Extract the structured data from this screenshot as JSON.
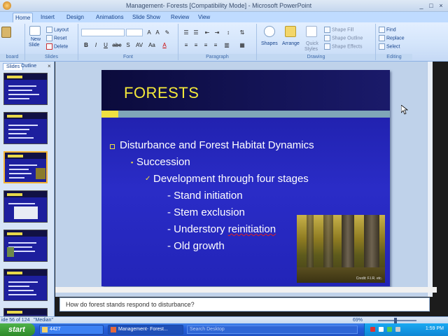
{
  "window": {
    "title": "Management- Forests [Compatibility Mode] - Microsoft PowerPoint",
    "controls": [
      "_",
      "□",
      "×"
    ]
  },
  "ribbon": {
    "tabs": [
      "Home",
      "Insert",
      "Design",
      "Animations",
      "Slide Show",
      "Review",
      "View"
    ],
    "active_tab": "Home",
    "clipboard_label": "board",
    "slides_group": {
      "label": "Slides",
      "new_slide": "New",
      "new_slide_2": "Slide",
      "layout": "Layout",
      "reset": "Reset",
      "delete": "Delete"
    },
    "font_group": {
      "label": "Font",
      "bold": "B",
      "italic": "I",
      "underline": "U",
      "strike": "abc",
      "shadow": "S",
      "spacing": "AV",
      "case": "Aa",
      "color": "A"
    },
    "paragraph_group": {
      "label": "Paragraph"
    },
    "drawing_group": {
      "label": "Drawing",
      "shapes": "Shapes",
      "arrange": "Arrange",
      "quick_styles": "Quick",
      "quick_styles_2": "Styles",
      "shape_fill": "Shape Fill",
      "shape_outline": "Shape Outline",
      "shape_effects": "Shape Effects"
    },
    "editing_group": {
      "label": "Editing",
      "find": "Find",
      "replace": "Replace",
      "select": "Select"
    }
  },
  "left_panel": {
    "tabs": [
      "Slides",
      "Outline"
    ],
    "close": "×",
    "thumbnail_title": "FORESTS"
  },
  "slide": {
    "title": "FORESTS",
    "bullets": [
      "Disturbance and Forest Habitat Dynamics",
      "Succession",
      "Development through four stages",
      "- Stand initiation",
      "- Stem exclusion",
      "- Understory ",
      "reinitiation",
      "- Old growth"
    ],
    "bullet_glyphs": {
      "level2": "▪",
      "level3": "✓"
    },
    "photo_credit": "Credit: F.I.R. etc."
  },
  "notes": {
    "text": "How do forest stands respond to disturbance?"
  },
  "status": {
    "slide_info": "ide 56 of 124",
    "theme": "\"Median\"",
    "zoom": "69%"
  },
  "taskbar": {
    "start": "start",
    "tasks": [
      "4427",
      "Management- Forest..."
    ],
    "search_placeholder": "Search Desktop",
    "clock": "1:59 PM"
  },
  "colors": {
    "slide_bg": "#2224b8",
    "title_yellow": "#f3e83a",
    "ribbon_blue": "#bfdbff",
    "selection_orange": "#f2b233"
  }
}
